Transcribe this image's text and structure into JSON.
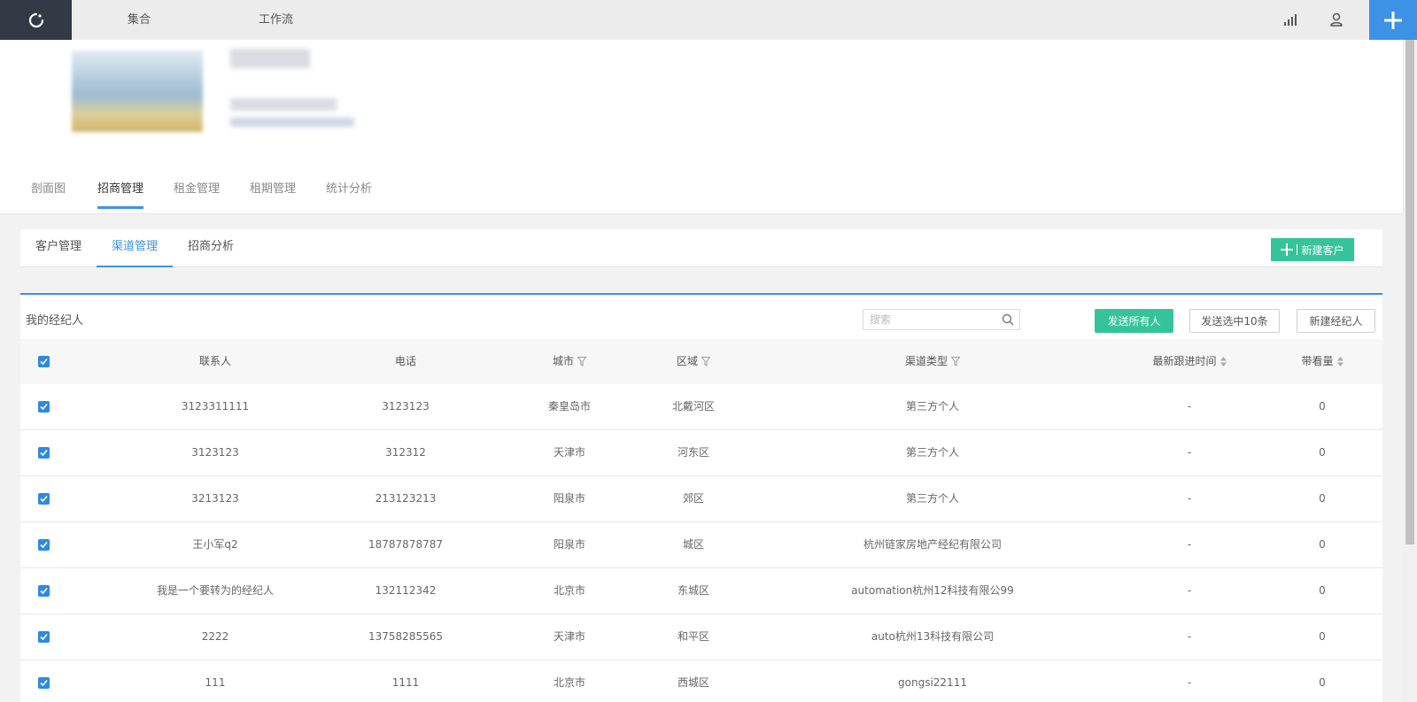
{
  "topbar": {
    "nav": [
      "集合",
      "工作流"
    ],
    "icons": [
      "refresh-icon",
      "chart-icon",
      "user-icon",
      "plus-icon"
    ],
    "colors": {
      "dark": "#333a45",
      "accent": "#3d92e6"
    }
  },
  "main_tabs": [
    {
      "label": "剖面图",
      "active": false
    },
    {
      "label": "招商管理",
      "active": true
    },
    {
      "label": "租金管理",
      "active": false
    },
    {
      "label": "租期管理",
      "active": false
    },
    {
      "label": "统计分析",
      "active": false
    }
  ],
  "sub_tabs": [
    {
      "label": "客户管理",
      "active": false
    },
    {
      "label": "渠道管理",
      "active": true
    },
    {
      "label": "招商分析",
      "active": false
    }
  ],
  "new_customer_label": "新建客户",
  "card": {
    "title": "我的经纪人",
    "search_placeholder": "搜索",
    "buttons": {
      "send_all": "发送所有人",
      "send_selected": "发送选中10条",
      "new_agent": "新建经纪人"
    }
  },
  "table": {
    "headers": {
      "contact": "联系人",
      "phone": "电话",
      "city": "城市",
      "district": "区域",
      "channel": "渠道类型",
      "latest": "最新跟进时间",
      "visits": "带看量"
    },
    "rows": [
      {
        "contact": "3123311111",
        "phone": "3123123",
        "city": "秦皇岛市",
        "district": "北戴河区",
        "channel": "第三方个人",
        "latest": "-",
        "visits": "0",
        "checked": true
      },
      {
        "contact": "3123123",
        "phone": "312312",
        "city": "天津市",
        "district": "河东区",
        "channel": "第三方个人",
        "latest": "-",
        "visits": "0",
        "checked": true
      },
      {
        "contact": "3213123",
        "phone": "213123213",
        "city": "阳泉市",
        "district": "郊区",
        "channel": "第三方个人",
        "latest": "-",
        "visits": "0",
        "checked": true
      },
      {
        "contact": "王小军q2",
        "phone": "18787878787",
        "city": "阳泉市",
        "district": "城区",
        "channel": "杭州链家房地产经纪有限公司",
        "latest": "-",
        "visits": "0",
        "checked": true
      },
      {
        "contact": "我是一个要转为的经纪人",
        "phone": "132112342",
        "city": "北京市",
        "district": "东城区",
        "channel": "automation杭州12科技有限公99",
        "latest": "-",
        "visits": "0",
        "checked": true
      },
      {
        "contact": "2222",
        "phone": "13758285565",
        "city": "天津市",
        "district": "和平区",
        "channel": "auto杭州13科技有限公司",
        "latest": "-",
        "visits": "0",
        "checked": true
      },
      {
        "contact": "111",
        "phone": "1111",
        "city": "北京市",
        "district": "西城区",
        "channel": "gongsi22111",
        "latest": "-",
        "visits": "0",
        "checked": true
      }
    ]
  }
}
